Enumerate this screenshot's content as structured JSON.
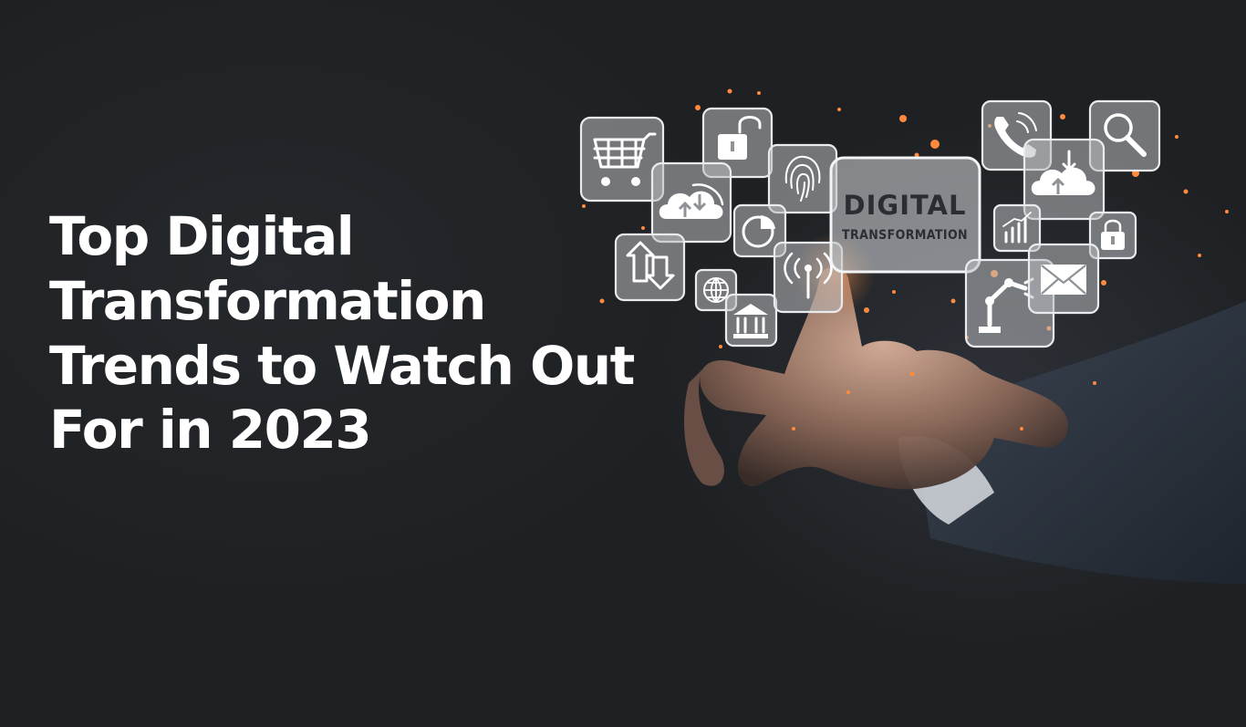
{
  "headline": {
    "lines": [
      "Top Digital",
      "Transformation",
      "Trends to Watch Out",
      "For in 2023"
    ]
  },
  "center_tile": {
    "title": "DIGITAL",
    "subtitle": "TRANSFORMATION"
  },
  "icons": [
    "shopping-cart-icon",
    "unlock-icon",
    "fingerprint-icon",
    "cloud-sync-icon",
    "pie-chart-icon",
    "arrows-icon",
    "globe-icon",
    "bank-icon",
    "signal-icon",
    "phone-icon",
    "search-icon",
    "cloud-upload-icon",
    "bar-chart-icon",
    "padlock-icon",
    "robot-arm-icon",
    "mail-icon"
  ],
  "colors": {
    "background": "#1e2023",
    "headline": "#ffffff",
    "glow": "#ff8a3d"
  }
}
